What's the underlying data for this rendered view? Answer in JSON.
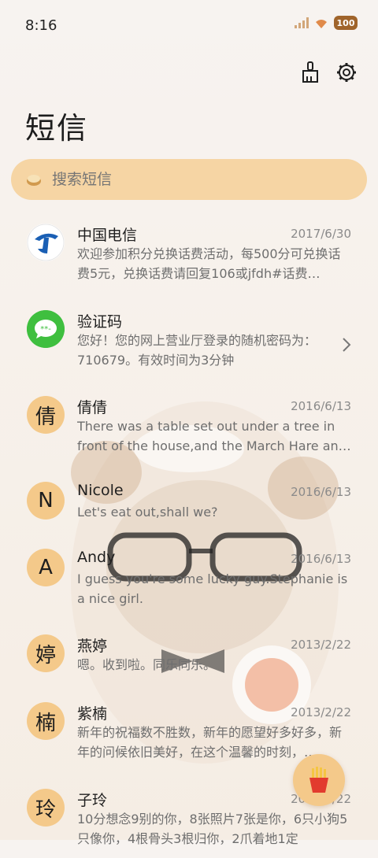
{
  "status": {
    "time": "8:16",
    "battery": "100"
  },
  "header": {
    "title": "短信"
  },
  "search": {
    "placeholder": "搜索短信"
  },
  "conversations": [
    {
      "name": "中国电信",
      "date": "2017/6/30",
      "preview": "欢迎参加积分兑换话费活动，每500分可兑换话费5元，兑换话费请回复106或jfdh#话费…",
      "avatar": "telecom-logo"
    },
    {
      "name": "验证码",
      "date": "",
      "preview": "您好！您的网上营业厅登录的随机密码为：710679。有效时间为3分钟",
      "avatar": "message-logo"
    },
    {
      "name": "倩倩",
      "date": "2016/6/13",
      "preview": "There was a table set out under a tree in front of the house,and the March Hare an…",
      "avatar_letter": "倩"
    },
    {
      "name": "Nicole",
      "date": "2016/6/13",
      "preview": "Let's eat out,shall we?",
      "avatar_letter": "N"
    },
    {
      "name": "Andy",
      "date": "2016/6/13",
      "preview": "I guess you're some lucky guy.Stephanie is a nice girl.",
      "avatar_letter": "A"
    },
    {
      "name": "燕婷",
      "date": "2013/2/22",
      "preview": "嗯。收到啦。同乐同乐。",
      "avatar_letter": "婷"
    },
    {
      "name": "紫楠",
      "date": "2013/2/22",
      "preview": "新年的祝福数不胜数，新年的愿望好多好多，新年的问候依旧美好，在这个温馨的时刻，…",
      "avatar_letter": "楠"
    },
    {
      "name": "子玲",
      "date": "2013/2/22",
      "preview": "10分想念9别的你，8张照片7张是你，6只小狗5只像你，4根骨头3根归你，2爪着地1定",
      "avatar_letter": "玲"
    }
  ],
  "colors": {
    "accent": "#f4c98a",
    "search_bg": "#f6d5a4",
    "telecom_blue": "#1a5fb4",
    "message_green": "#3fbf3f"
  },
  "icons": {
    "clean": "broom-icon",
    "settings": "gear-icon",
    "fab": "fries-icon"
  }
}
